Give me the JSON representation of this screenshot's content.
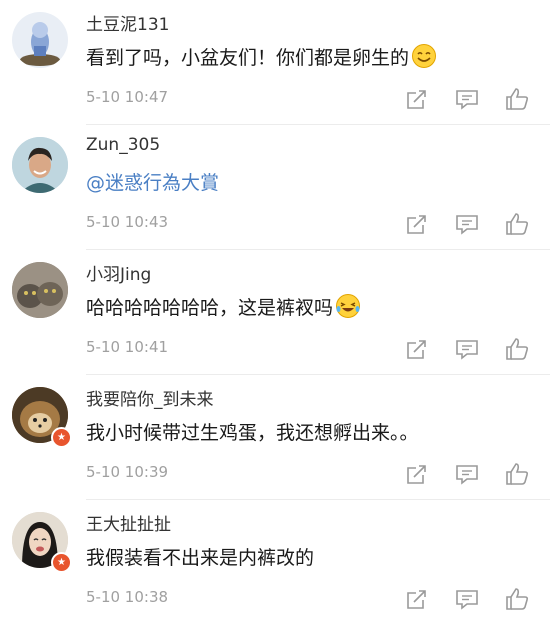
{
  "colors": {
    "mention": "#4a7fc4",
    "timestamp": "#a0a0a0",
    "badge": "#e8552e"
  },
  "icons": {
    "share": "share-icon",
    "reply": "comment-icon",
    "like": "thumbs-up-icon",
    "verified": "verified-badge-icon"
  },
  "comments": [
    {
      "username": "土豆泥131",
      "text": "看到了吗，小盆友们！你们都是卵生的",
      "emoji": "smile-emoji",
      "time": "5-10 10:47"
    },
    {
      "username": "Zun_305",
      "mention": "@迷惑行為大賞",
      "time": "5-10 10:43"
    },
    {
      "username": "小羽Jing",
      "text": "哈哈哈哈哈哈哈，这是裤衩吗",
      "emoji": "laughing-tears-emoji",
      "time": "5-10 10:41"
    },
    {
      "username": "我要陪你_到未来",
      "text": "我小时候带过生鸡蛋，我还想孵出来。。",
      "verified": true,
      "time": "5-10 10:39"
    },
    {
      "username": "王大扯扯扯",
      "text": "我假装看不出来是内裤改的",
      "verified": true,
      "time": "5-10 10:38"
    }
  ]
}
